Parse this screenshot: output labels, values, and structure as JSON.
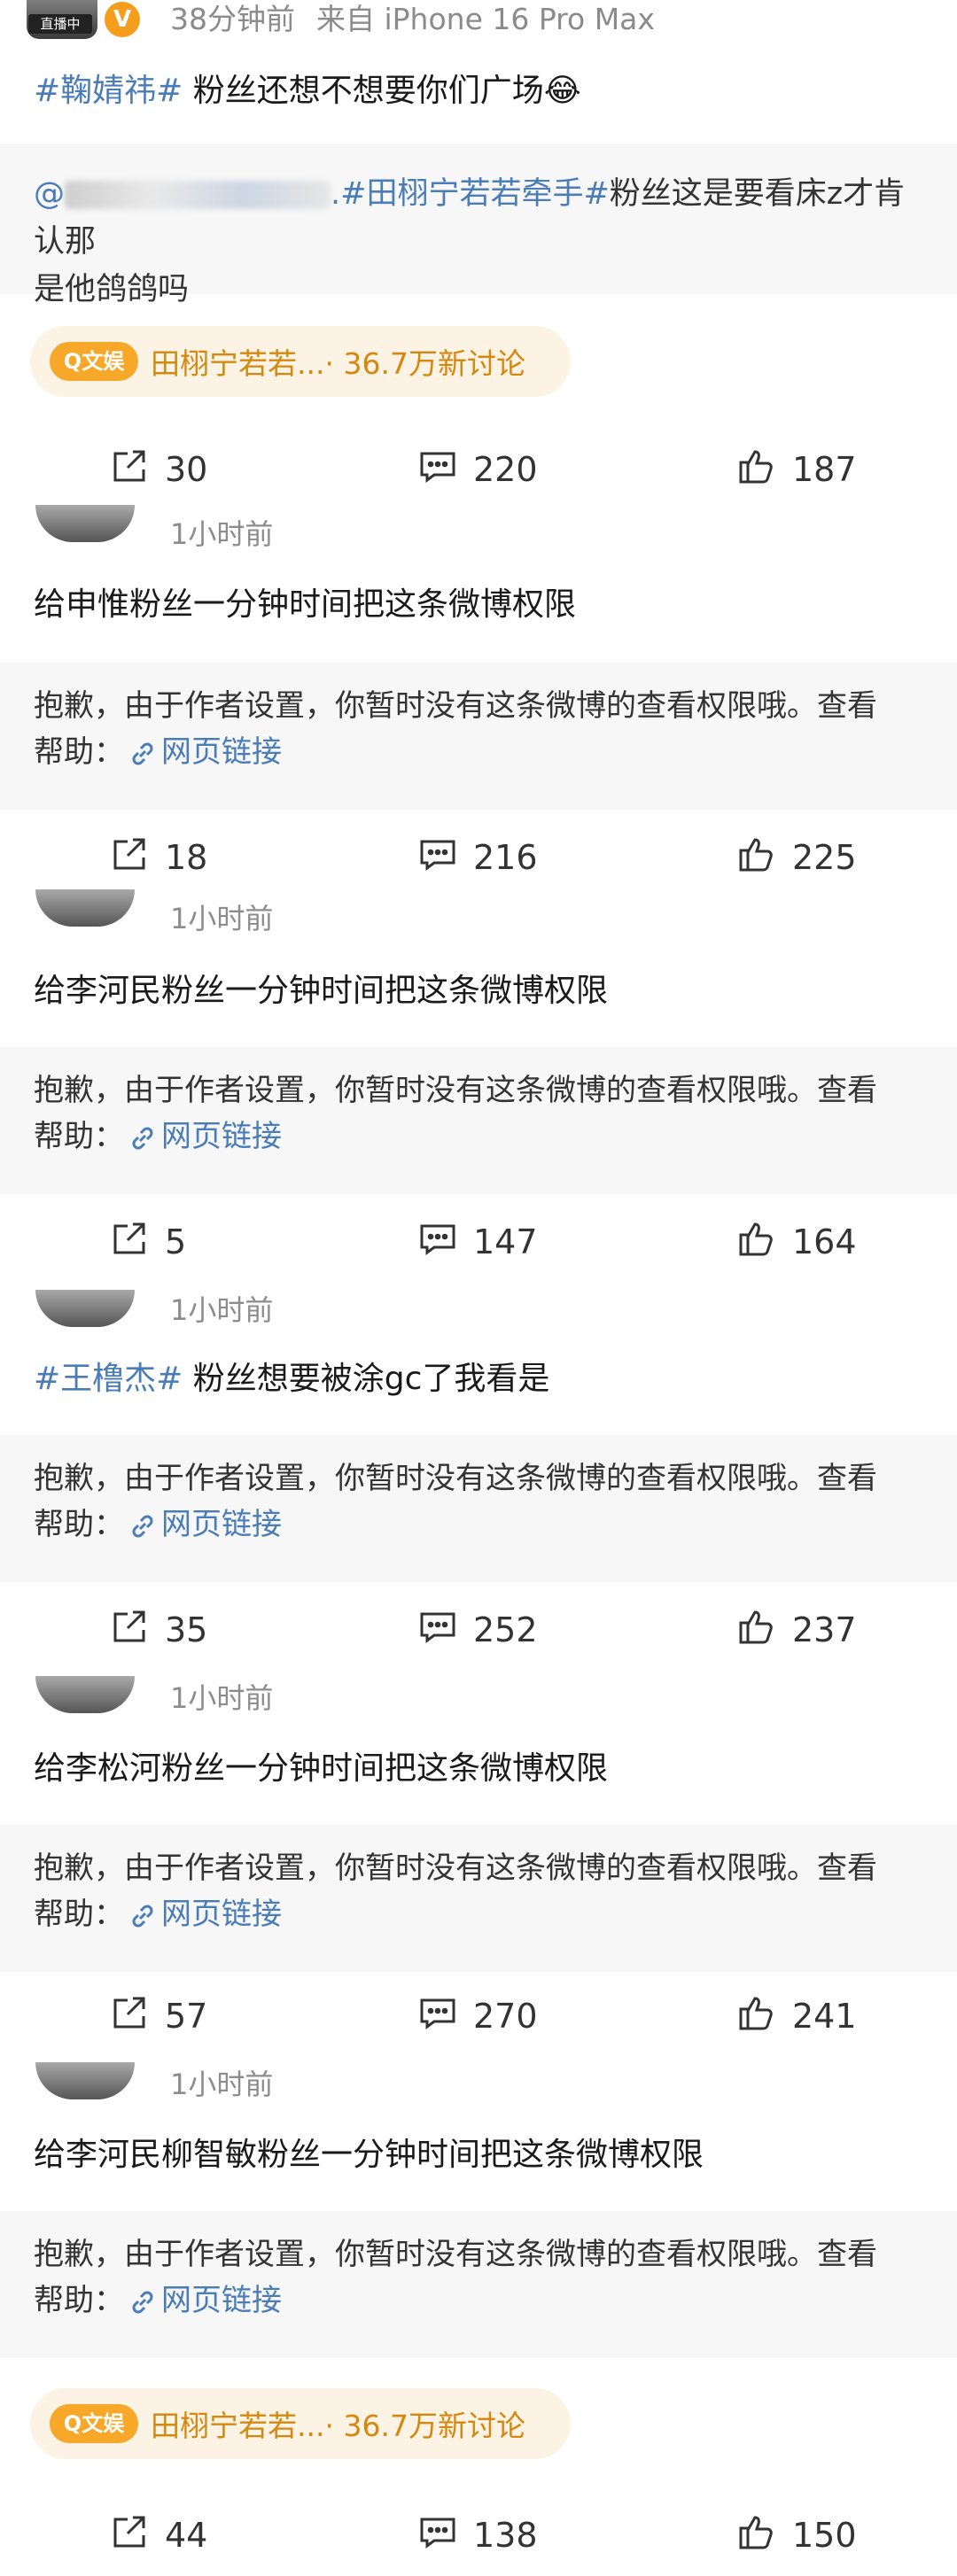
{
  "header": {
    "live_badge": "直播中",
    "verified": "V",
    "time": "38分钟前",
    "source": "来自 iPhone 16 Pro Max"
  },
  "post": {
    "tag": "#鞠婧祎#",
    "text": " 粉丝还想不想要你们广场😂"
  },
  "quote": {
    "mention_prefix": "@",
    "tag": ".#田栩宁若若牵手#",
    "text_line1": "粉丝这是要看床z才肯认那",
    "text_line2": "是他鸽鸽吗"
  },
  "topic": {
    "logo": "Q文娱",
    "name": "田栩宁若若...",
    "count": "· 36.7万新讨论"
  },
  "action_bars": [
    {
      "share": "30",
      "comment": "220",
      "like": "187"
    },
    {
      "share": "18",
      "comment": "216",
      "like": "225"
    },
    {
      "share": "5",
      "comment": "147",
      "like": "164"
    },
    {
      "share": "35",
      "comment": "252",
      "like": "237"
    },
    {
      "share": "57",
      "comment": "270",
      "like": "241"
    },
    {
      "share": "44",
      "comment": "138",
      "like": "150"
    }
  ],
  "comments": [
    {
      "time": "1小时前",
      "text": "给申惟粉丝一分钟时间把这条微博权限"
    },
    {
      "time": "1小时前",
      "text": "给李河民粉丝一分钟时间把这条微博权限"
    },
    {
      "time": "1小时前",
      "tag": "#王橹杰#",
      "text": " 粉丝想要被涂gc了我看是"
    },
    {
      "time": "1小时前",
      "text": "给李松河粉丝一分钟时间把这条微博权限"
    },
    {
      "time": "1小时前",
      "text": "给李河民柳智敏粉丝一分钟时间把这条微博权限"
    }
  ],
  "notice": {
    "line1": "抱歉，由于作者设置，你暂时没有这条微博的查看权限哦。查看",
    "line2_prefix": "帮助：",
    "link": "网页链接"
  },
  "icons": {
    "share": "share-icon",
    "comment": "comment-icon",
    "like": "like-icon",
    "link": "link-icon"
  },
  "colors": {
    "tag": "#4a7cb7",
    "topic_bg": "#fdf3e4",
    "topic_text": "#d48810",
    "verified": "#f59d1c"
  }
}
